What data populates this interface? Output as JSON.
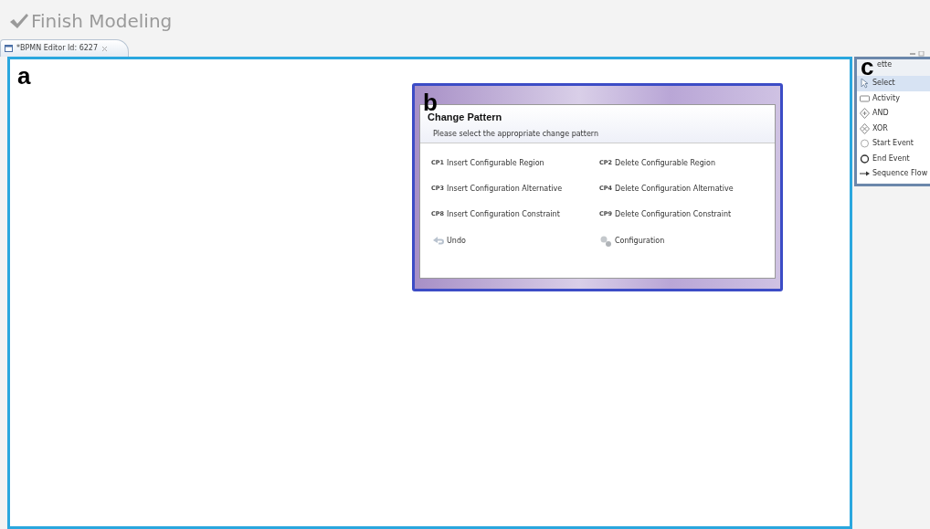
{
  "toolbar": {
    "finish_button": "Finish Modeling"
  },
  "editor_tab": {
    "label": "*BPMN Editor Id: 6227",
    "selected": true
  },
  "figure_labels": [
    "a",
    "b",
    "c"
  ],
  "dialog": {
    "title": "Change Pattern",
    "message": "Please select the appropriate change pattern",
    "patterns": [
      {
        "code": "CP1",
        "label": "Insert Configurable Region"
      },
      {
        "code": "CP2",
        "label": "Delete Configurable Region"
      },
      {
        "code": "CP3",
        "label": "Insert Configuration Alternative"
      },
      {
        "code": "CP4",
        "label": "Delete Configuration Alternative"
      },
      {
        "code": "CP8",
        "label": "Insert Configuration Constraint"
      },
      {
        "code": "CP9",
        "label": "Delete Configuration Constraint"
      }
    ],
    "actions": [
      {
        "kind": "undo",
        "label": "Undo"
      },
      {
        "kind": "configuration",
        "label": "Configuration"
      }
    ]
  },
  "palette": {
    "title": "ette",
    "items": [
      {
        "kind": "select",
        "label": "Select",
        "selected": true
      },
      {
        "kind": "activity",
        "label": "Activity",
        "selected": false
      },
      {
        "kind": "and",
        "label": "AND",
        "selected": false
      },
      {
        "kind": "xor",
        "label": "XOR",
        "selected": false
      },
      {
        "kind": "start",
        "label": "Start Event",
        "selected": false
      },
      {
        "kind": "end",
        "label": "End Event",
        "selected": false
      },
      {
        "kind": "flow",
        "label": "Sequence Flow",
        "selected": false
      }
    ]
  }
}
